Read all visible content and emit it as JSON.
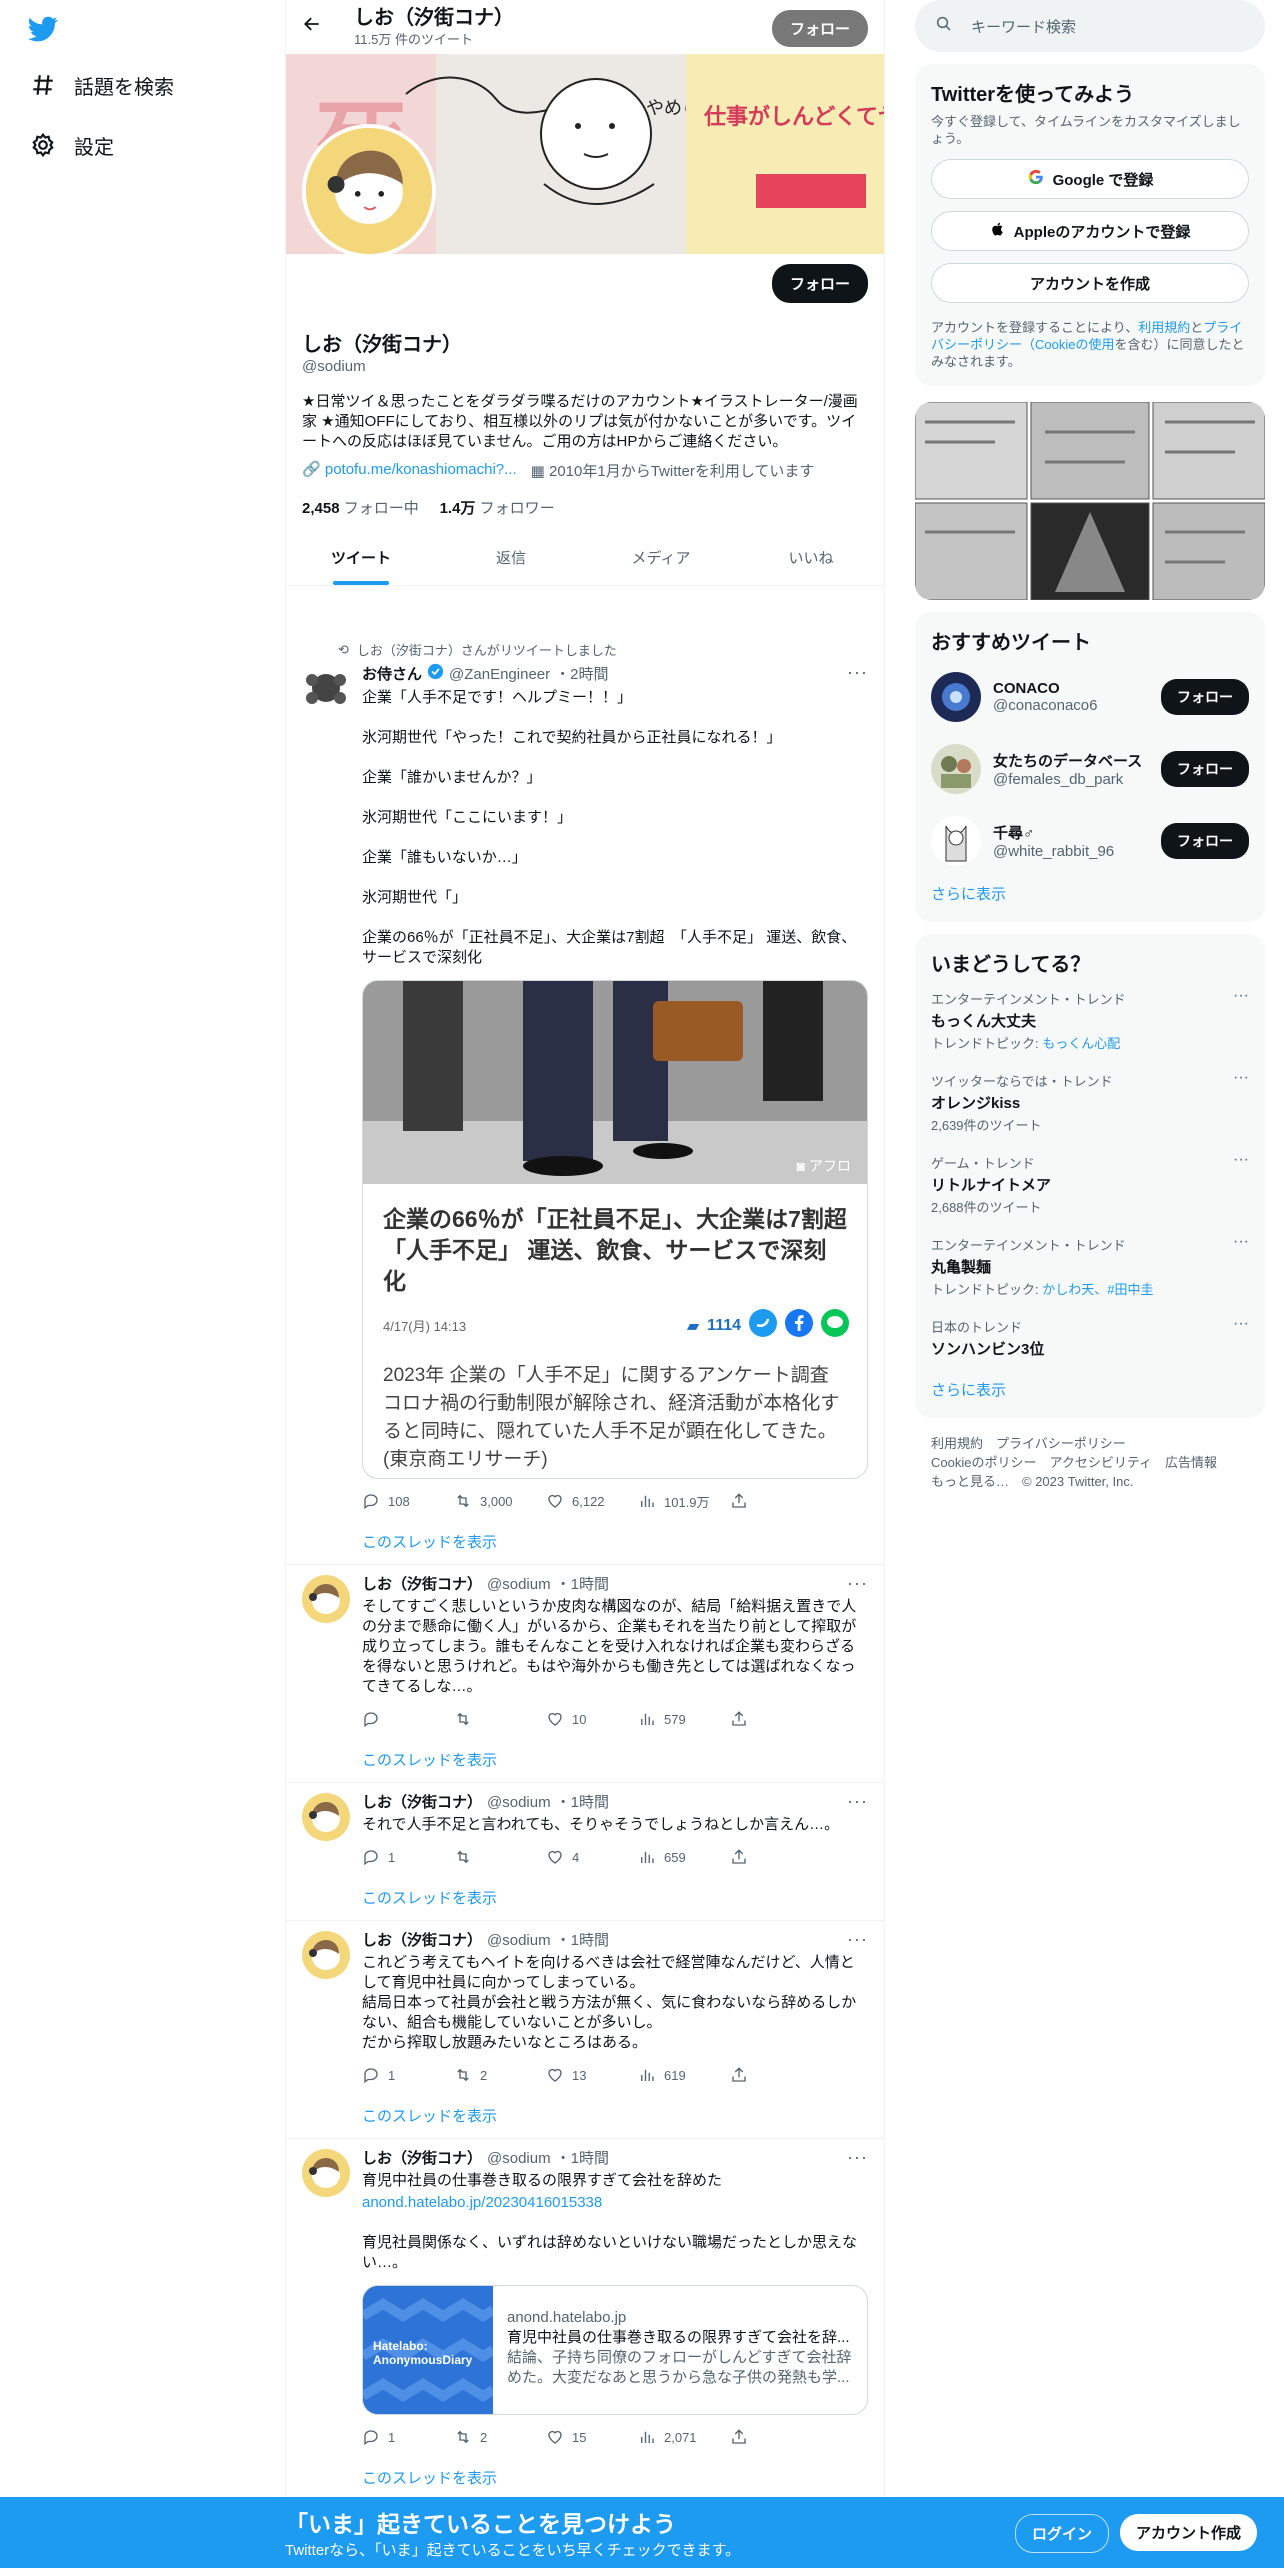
{
  "nav": {
    "explore": "話題を検索",
    "settings": "設定"
  },
  "header": {
    "title": "しお（汐街コナ）",
    "subtitle": "11.5万 件のツイート",
    "follow": "フォロー"
  },
  "banner": {
    "text_a": "やめられない",
    "text_b": "仕事がしんどくてヤバい"
  },
  "profile": {
    "name": "しお（汐街コナ）",
    "handle": "@sodium",
    "follow": "フォロー",
    "bio": "★日常ツイ＆思ったことをダラダラ喋るだけのアカウント★イラストレーター/漫画家 ★通知OFFにしており、相互様以外のリプは気が付かないことが多いです。ツイートへの反応はほぼ見ていません。ご用の方はHPからご連絡ください。",
    "link": "potofu.me/konashiomachi?...",
    "joined": "2010年1月からTwitterを利用しています",
    "following_count": "2,458",
    "following_label": "フォロー中",
    "followers_count": "1.4万",
    "followers_label": "フォロワー"
  },
  "tabs": [
    "ツイート",
    "返信",
    "メディア",
    "いいね"
  ],
  "tweets": [
    {
      "retweet_note": "しお（汐街コナ）さんがリツイートしました",
      "name": "お侍さん",
      "handle": "@ZanEngineer",
      "time": "・2時間",
      "text": "企業「人手不足です！ヘルプミー！！」\n\n氷河期世代「やった！これで契約社員から正社員になれる！」\n\n企業「誰かいませんか？」\n\n氷河期世代「ここにいます！」\n\n企業「誰もいないか…」\n\n氷河期世代「」\n\n企業の66％が「正社員不足」、大企業は7割超　「人手不足」 運送、飲食、サービスで深刻化",
      "card": {
        "credit": "アフロ",
        "title": "企業の66％が「正社員不足」、大企業は7割超　「人手不足」 運送、飲食、サービスで深刻化",
        "date": "4/17(月) 14:13",
        "comments": "1114",
        "body": "2023年 企業の「人手不足」に関するアンケート調査　コロナ禍の行動制限が解除され、経済活動が本格化すると同時に、隠れていた人手不足が顕在化してきた。(東京商エリサーチ)"
      },
      "replies": "108",
      "retweets": "3,000",
      "likes": "6,122",
      "views": "101.9万",
      "show_thread": "このスレッドを表示"
    },
    {
      "name": "しお（汐街コナ）",
      "handle": "@sodium",
      "time": "・1時間",
      "text": "そしてすごく悲しいというか皮肉な構図なのが、結局「給料据え置きで人の分まで懸命に働く人」がいるから、企業もそれを当たり前として搾取が成り立ってしまう。誰もそんなことを受け入れなければ企業も変わらざるを得ないと思うけれど。もはや海外からも働き先としては選ばれなくなってきてるしな…。",
      "replies": "",
      "retweets": "",
      "likes": "10",
      "views": "579",
      "show_thread": "このスレッドを表示"
    },
    {
      "name": "しお（汐街コナ）",
      "handle": "@sodium",
      "time": "・1時間",
      "text": "それで人手不足と言われても、そりゃそうでしょうねとしか言えん…。",
      "replies": "1",
      "retweets": "",
      "likes": "4",
      "views": "659",
      "show_thread": "このスレッドを表示"
    },
    {
      "name": "しお（汐街コナ）",
      "handle": "@sodium",
      "time": "・1時間",
      "text": "これどう考えてもヘイトを向けるべきは会社で経営陣なんだけど、人情として育児中社員に向かってしまっている。\n結局日本って社員が会社と戦う方法が無く、気に食わないなら辞めるしかない、組合も機能していないことが多いし。\nだから搾取し放題みたいなところはある。",
      "replies": "1",
      "retweets": "2",
      "likes": "13",
      "views": "619",
      "show_thread": "このスレッドを表示"
    },
    {
      "name": "しお（汐街コナ）",
      "handle": "@sodium",
      "time": "・1時間",
      "text": "育児中社員の仕事巻き取るの限界すぎて会社を辞めた",
      "link": "anond.hatelabo.jp/20230416015338",
      "text2": "育児社員関係なく、いずれは辞めないといけない職場だったとしか思えない…。",
      "card": {
        "img_label_1": "Hatelabo:",
        "img_label_2": "AnonymousDiary",
        "domain": "anond.hatelabo.jp",
        "title": "育児中社員の仕事巻き取るの限界すぎて会社を辞...",
        "desc": "結論、子持ち同僚のフォローがしんどすぎて会社辞めた。大変だなあと思うから急な子供の発熱も学..."
      },
      "replies": "1",
      "retweets": "2",
      "likes": "15",
      "views": "2,071",
      "show_thread": "このスレッドを表示"
    }
  ],
  "right": {
    "search_placeholder": "キーワード検索",
    "signup": {
      "title": "Twitterを使ってみよう",
      "desc": "今すぐ登録して、タイムラインをカスタマイズしましょう。",
      "google": "Google で登録",
      "apple": "Appleのアカウントで登録",
      "create": "アカウントを作成",
      "terms_a": "アカウントを登録することにより、",
      "terms_link1": "利用規約",
      "terms_b": "と",
      "terms_link2": "プライバシーポリシー（Cookieの使用",
      "terms_c": "を含む）に同意したとみなされます。"
    },
    "recommend": {
      "title": "おすすめツイート",
      "items": [
        {
          "name": "CONACO",
          "handle": "@conaconaco6",
          "follow": "フォロー"
        },
        {
          "name": "女たちのデータベース",
          "handle": "@females_db_park",
          "follow": "フォロー"
        },
        {
          "name": "千尋♂",
          "handle": "@white_rabbit_96",
          "follow": "フォロー"
        }
      ],
      "more": "さらに表示"
    },
    "trends": {
      "title": "いまどうしてる？",
      "items": [
        {
          "category": "エンターテインメント・トレンド",
          "name": "もっくん大丈夫",
          "sub_prefix": "トレンドトピック: ",
          "sub_link": "もっくん心配"
        },
        {
          "category": "ツイッターならでは・トレンド",
          "name": "オレンジkiss",
          "sub_prefix": "2,639件のツイート",
          "sub_link": ""
        },
        {
          "category": "ゲーム・トレンド",
          "name": "リトルナイトメア",
          "sub_prefix": "2,688件のツイート",
          "sub_link": ""
        },
        {
          "category": "エンターテインメント・トレンド",
          "name": "丸亀製麺",
          "sub_prefix": "トレンドトピック: ",
          "sub_link": "かしわ天、#田中圭"
        },
        {
          "category": "日本のトレンド",
          "name": "ソンハンビン3位",
          "sub_prefix": "",
          "sub_link": ""
        }
      ],
      "more": "さらに表示"
    },
    "footer": {
      "line1": "利用規約　プライバシーポリシー",
      "line2": "Cookieのポリシー　アクセシビリティ　広告情報",
      "line3": "もっと見る…　© 2023 Twitter, Inc."
    }
  },
  "bottom": {
    "headline": "「いま」起きていることを見つけよう",
    "sub": "Twitterなら、「いま」起きていることをいち早くチェックできます。",
    "login": "ログイン",
    "signup": "アカウント作成"
  },
  "colors": {
    "accent": "#1d9bf0",
    "text": "#0f1419",
    "muted": "#536471",
    "avatar": "#f3d77a"
  }
}
